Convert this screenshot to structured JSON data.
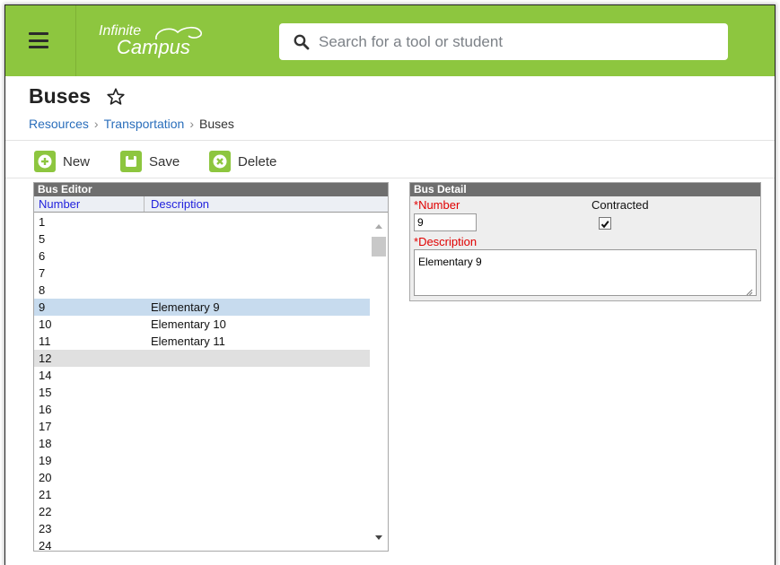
{
  "app": {
    "logo_line1": "Infinite",
    "logo_line2": "Campus",
    "search_placeholder": "Search for a tool or student"
  },
  "page": {
    "title": "Buses",
    "breadcrumb": [
      "Resources",
      "Transportation",
      "Buses"
    ]
  },
  "toolbar": {
    "new_label": "New",
    "save_label": "Save",
    "delete_label": "Delete"
  },
  "editor": {
    "title": "Bus Editor",
    "col_number": "Number",
    "col_description": "Description",
    "rows": [
      {
        "number": "1",
        "description": ""
      },
      {
        "number": "5",
        "description": ""
      },
      {
        "number": "6",
        "description": ""
      },
      {
        "number": "7",
        "description": ""
      },
      {
        "number": "8",
        "description": ""
      },
      {
        "number": "9",
        "description": "Elementary 9"
      },
      {
        "number": "10",
        "description": "Elementary 10"
      },
      {
        "number": "11",
        "description": "Elementary 11"
      },
      {
        "number": "12",
        "description": ""
      },
      {
        "number": "14",
        "description": ""
      },
      {
        "number": "15",
        "description": ""
      },
      {
        "number": "16",
        "description": ""
      },
      {
        "number": "17",
        "description": ""
      },
      {
        "number": "18",
        "description": ""
      },
      {
        "number": "19",
        "description": ""
      },
      {
        "number": "20",
        "description": ""
      },
      {
        "number": "21",
        "description": ""
      },
      {
        "number": "22",
        "description": ""
      },
      {
        "number": "23",
        "description": ""
      },
      {
        "number": "24",
        "description": ""
      }
    ]
  },
  "detail": {
    "title": "Bus Detail",
    "number_label": "Number",
    "number_value": "9",
    "contracted_label": "Contracted",
    "contracted_checked": true,
    "description_label": "Description",
    "description_value": "Elementary 9",
    "required_mark": "*"
  },
  "colors": {
    "brand_green": "#8dc63f",
    "link_blue": "#2a6ebb",
    "selected_row": "#c7dbee",
    "required_red": "#e00000"
  }
}
